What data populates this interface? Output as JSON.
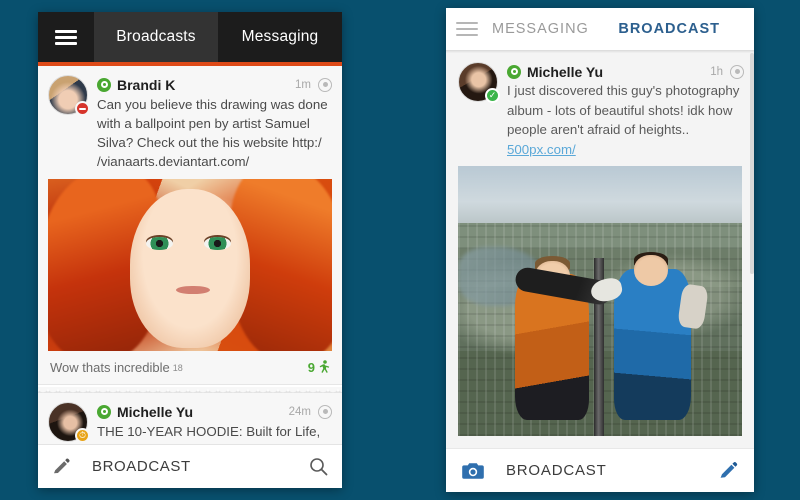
{
  "background_color": "#08506e",
  "left_phone": {
    "accent_color": "#de4a18",
    "menu_icon": "hamburger-icon",
    "tabs": [
      {
        "label": "Broadcasts",
        "active": true
      },
      {
        "label": "Messaging",
        "active": false
      }
    ],
    "posts": [
      {
        "author": "Brandi  K",
        "verified_icon": "verified-star-icon",
        "avatar_badge": "blocked-badge",
        "time": "1m",
        "menu_icon": "record-dot-icon",
        "text": "Can you believe this drawing was done with a ballpoint pen by artist Samuel Silva? Check out the his website http:/ /vianaarts.deviantart.com/",
        "image_alt": "ballpoint-pen-portrait-red-haired-girl",
        "comment": "Wow thats incredible",
        "comment_count": "18",
        "reaction_count": "9",
        "reaction_icon": "runner-icon",
        "reaction_color": "#4aa832"
      },
      {
        "author": "Michelle  Yu",
        "verified_icon": "verified-star-icon",
        "avatar_badge": "pending-badge",
        "time": "24m",
        "menu_icon": "record-dot-icon",
        "text": "THE 10-YEAR HOODIE: Built for Life,"
      }
    ],
    "bottom_bar": {
      "left_icon": "pencil-icon",
      "label": "BROADCAST",
      "right_icon": "search-icon"
    }
  },
  "right_phone": {
    "accent_color": "#2c5f8e",
    "menu_icon": "hamburger-icon",
    "tabs": [
      {
        "label": "MESSAGING",
        "active": false
      },
      {
        "label": "BROADCAST",
        "active": true
      }
    ],
    "post": {
      "author": "Michelle  Yu",
      "verified_icon": "verified-star-icon",
      "avatar_badge": "verified-check-badge",
      "time": "1h",
      "menu_icon": "record-dot-icon",
      "text_part1": "I just discovered this guy's photography album - lots of beautiful shots! idk how people aren't afraid of heights.. ",
      "link_text": "500px.com/",
      "image_alt": "aerial-selfie-two-men-on-tower-above-city"
    },
    "bottom_bar": {
      "left_icon": "camera-icon",
      "label": "BROADCAST",
      "right_icon": "pencil-icon"
    }
  }
}
